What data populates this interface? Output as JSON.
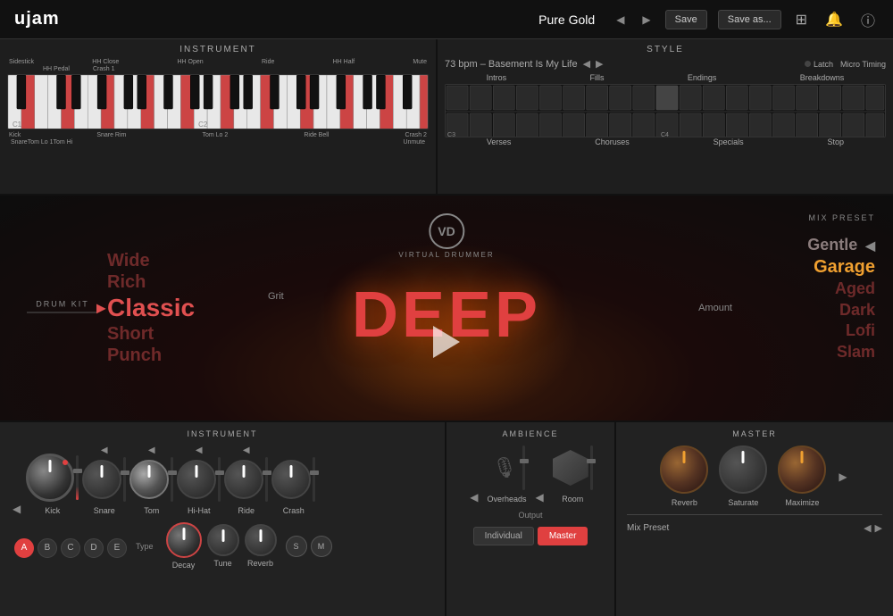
{
  "topbar": {
    "logo": "ujam",
    "preset": "Pure Gold",
    "save_label": "Save",
    "save_as_label": "Save as..."
  },
  "instrument_panel": {
    "title": "INSTRUMENT",
    "labels_top": [
      "Sidestick",
      "HH Close",
      "HH Pedal",
      "HH Open",
      "Crash 1",
      "Ride",
      "HH Half",
      "Mute"
    ],
    "labels_bottom": [
      "Kick",
      "Snare Rim",
      "Tom Lo 2",
      "Ride Bell",
      "Crash 2"
    ],
    "labels_bottom2": [
      "Snare",
      "Tom Lo 1",
      "Tom Hi",
      "Unmute"
    ]
  },
  "style_panel": {
    "title": "STYLE",
    "bpm": "73 bpm – Basement Is My Life",
    "latch": "Latch",
    "micro_timing": "Micro Timing",
    "categories_top": [
      "Intros",
      "Fills",
      "Endings",
      "Breakdowns"
    ],
    "categories_bottom": [
      "Verses",
      "Choruses",
      "Specials",
      "Stop"
    ]
  },
  "main": {
    "drum_kit_label": "DRUM KIT",
    "kit_items": [
      "Wide",
      "Rich",
      "Classic",
      "Short",
      "Punch"
    ],
    "active_kit": "Classic",
    "grit": "Grit",
    "vd_logo": "VD",
    "vd_subtitle": "VIRTUAL DRUMMER",
    "deep_text": "DEEP",
    "amount": "Amount",
    "mix_preset_label": "MIX PRESET",
    "preset_items": [
      "Gentle",
      "Garage",
      "Aged",
      "Dark",
      "Lofi",
      "Slam"
    ],
    "active_preset": "Garage"
  },
  "instrument_bottom": {
    "title": "INSTRUMENT",
    "channels": [
      {
        "label": "Kick"
      },
      {
        "label": "Snare"
      },
      {
        "label": "Tom"
      },
      {
        "label": "Hi-Hat"
      },
      {
        "label": "Ride"
      },
      {
        "label": "Crash"
      }
    ],
    "type_label": "Type",
    "type_buttons": [
      "A",
      "B",
      "C",
      "D",
      "E"
    ],
    "active_type": "A",
    "decay_label": "Decay",
    "tune_label": "Tune",
    "reverb_label": "Reverb",
    "sm_buttons": [
      "S",
      "M"
    ]
  },
  "ambience": {
    "title": "AMBIENCE",
    "channels": [
      {
        "label": "Overheads"
      },
      {
        "label": "Room"
      }
    ],
    "output_label": "Output",
    "individual_label": "Individual",
    "master_label": "Master"
  },
  "master": {
    "title": "MASTER",
    "knobs": [
      {
        "label": "Reverb"
      },
      {
        "label": "Saturate"
      },
      {
        "label": "Maximize"
      }
    ],
    "mix_preset_label": "Mix Preset"
  }
}
